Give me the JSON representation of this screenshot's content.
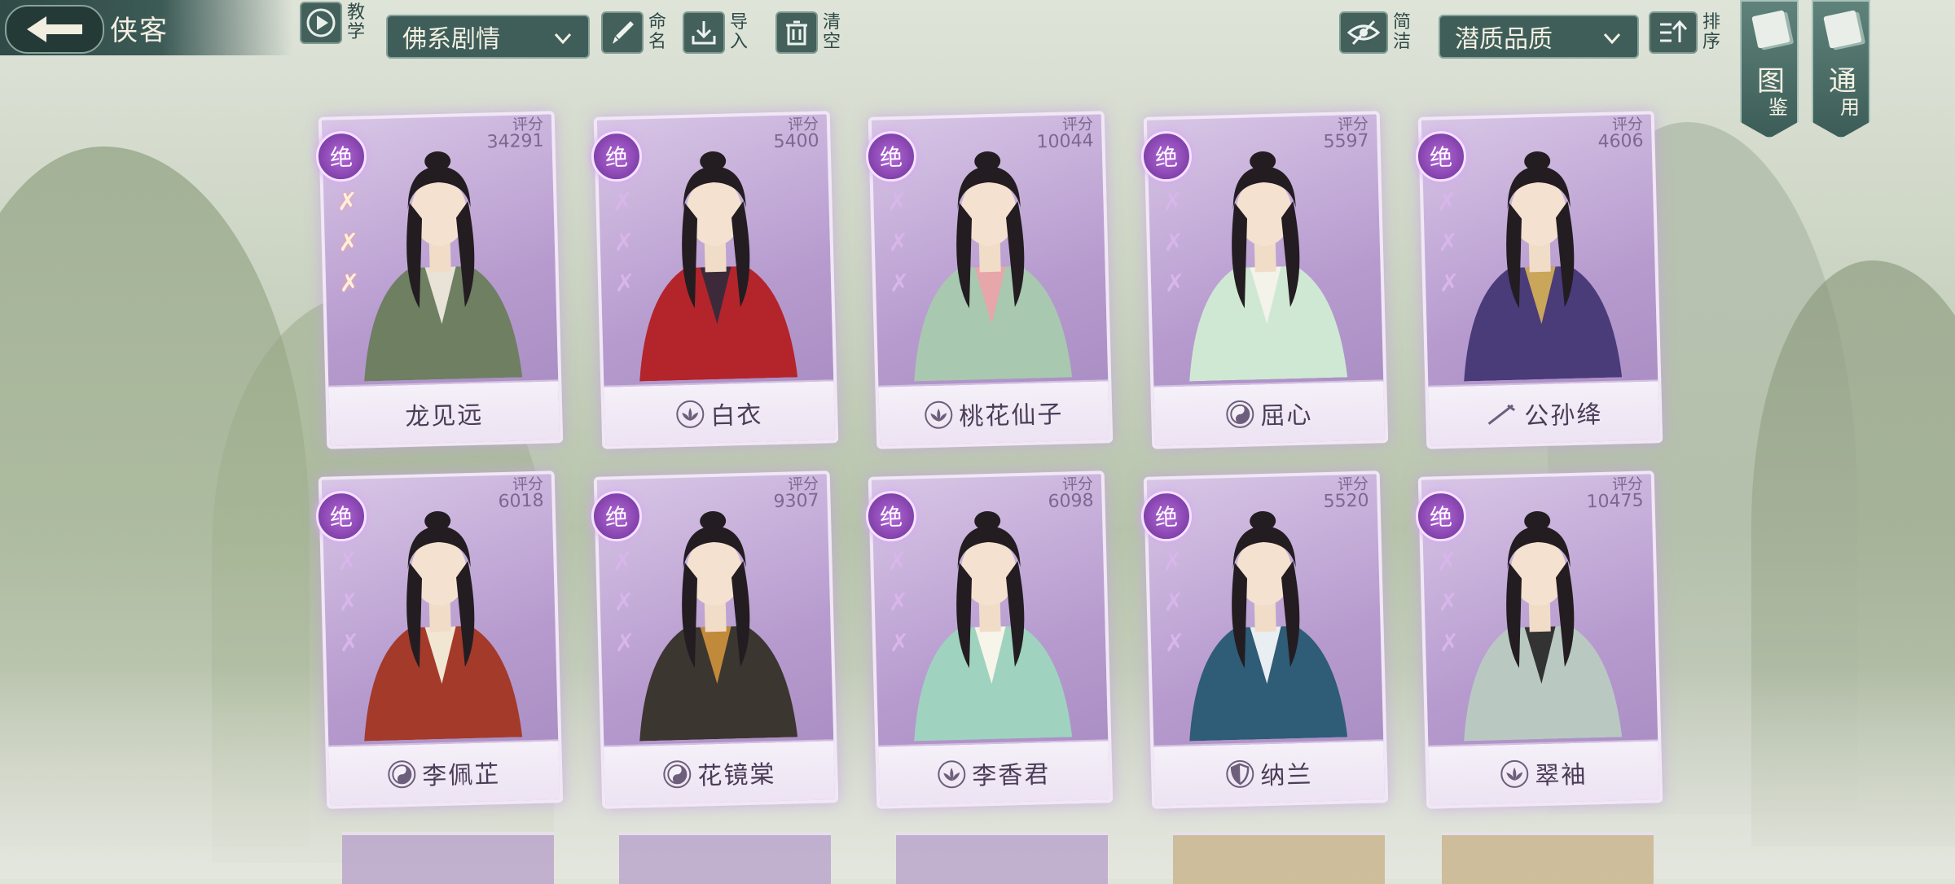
{
  "header": {
    "title": "侠客",
    "tutorial_label": "教学",
    "filter_dropdown": "佛系剧情",
    "rename_label": "命名",
    "import_label": "导入",
    "clear_label": "清空",
    "simple_label": "简洁",
    "sort_dropdown": "潜质品质",
    "sort_label": "排序"
  },
  "side_tabs": [
    {
      "label_top": "图",
      "label_bottom": "鉴"
    },
    {
      "label_top": "通",
      "label_bottom": "用"
    }
  ],
  "cards": [
    {
      "name": "龙见远",
      "rank": "绝",
      "score_label": "评分",
      "score": "34291",
      "sect_icon": "",
      "lit_stars": 3,
      "robe": "#6f7f62",
      "accent": "#e8e3d6"
    },
    {
      "name": "白衣",
      "rank": "绝",
      "score_label": "评分",
      "score": "5400",
      "sect_icon": "lotus-icon",
      "lit_stars": 0,
      "robe": "#b4242b",
      "accent": "#3c2a3a"
    },
    {
      "name": "桃花仙子",
      "rank": "绝",
      "score_label": "评分",
      "score": "10044",
      "sect_icon": "lotus-icon",
      "lit_stars": 0,
      "robe": "#a9c8b0",
      "accent": "#e7a6a9"
    },
    {
      "name": "屈心",
      "rank": "绝",
      "score_label": "评分",
      "score": "5597",
      "sect_icon": "yinyang-icon",
      "lit_stars": 0,
      "robe": "#cfe8d4",
      "accent": "#f3f3ea"
    },
    {
      "name": "公孙绛",
      "rank": "绝",
      "score_label": "评分",
      "score": "4606",
      "sect_icon": "sword-icon",
      "lit_stars": 0,
      "robe": "#4a3b79",
      "accent": "#c9a65a"
    },
    {
      "name": "李佩芷",
      "rank": "绝",
      "score_label": "评分",
      "score": "6018",
      "sect_icon": "yinyang-icon",
      "lit_stars": 0,
      "robe": "#a43a2a",
      "accent": "#f1e6d2"
    },
    {
      "name": "花镜棠",
      "rank": "绝",
      "score_label": "评分",
      "score": "9307",
      "sect_icon": "yinyang-icon",
      "lit_stars": 0,
      "robe": "#3b3630",
      "accent": "#c18a3a"
    },
    {
      "name": "李香君",
      "rank": "绝",
      "score_label": "评分",
      "score": "6098",
      "sect_icon": "lotus-icon",
      "lit_stars": 0,
      "robe": "#9fd3c0",
      "accent": "#f7f4ea"
    },
    {
      "name": "纳兰",
      "rank": "绝",
      "score_label": "评分",
      "score": "5520",
      "sect_icon": "shield-icon",
      "lit_stars": 0,
      "robe": "#2f5c76",
      "accent": "#e9eef2"
    },
    {
      "name": "翠袖",
      "rank": "绝",
      "score_label": "评分",
      "score": "10475",
      "sect_icon": "lotus-icon",
      "lit_stars": 0,
      "robe": "#b9c9c2",
      "accent": "#333"
    }
  ]
}
